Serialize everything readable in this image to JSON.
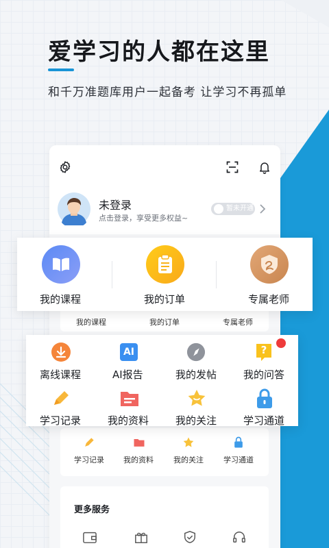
{
  "hero": {
    "title": "爱学习的人都在这里",
    "subtitle": "和千万准题库用户一起备考 让学习不再孤单"
  },
  "colors": {
    "accent_blue": "#1994d6",
    "course_blue": "#6b8df5",
    "order_yellow": "#fbbd15",
    "teacher_tan": "#d9955f"
  },
  "header_icons": [
    "gear-icon",
    "scan-icon",
    "bell-icon"
  ],
  "profile": {
    "name": "未登录",
    "hint": "点击登录，享受更多权益~",
    "vip_badge": "暂未开通"
  },
  "main_card": {
    "items": [
      {
        "label": "我的课程",
        "icon": "book-icon"
      },
      {
        "label": "我的订单",
        "icon": "clipboard-icon"
      },
      {
        "label": "专属老师",
        "icon": "teacher-badge-icon"
      }
    ]
  },
  "inner_main_labels": [
    "我的课程",
    "我的订单",
    "专属老师"
  ],
  "tools_card": {
    "row1": [
      {
        "label": "离线课程",
        "icon": "download-icon"
      },
      {
        "label": "AI报告",
        "icon": "ai-icon",
        "icon_text": "AI"
      },
      {
        "label": "我的发帖",
        "icon": "compass-icon"
      },
      {
        "label": "我的问答",
        "icon": "question-icon",
        "icon_text": "?"
      }
    ],
    "row2": [
      {
        "label": "学习记录",
        "icon": "pencil-icon"
      },
      {
        "label": "我的资料",
        "icon": "folder-icon"
      },
      {
        "label": "我的关注",
        "icon": "star-icon"
      },
      {
        "label": "学习通道",
        "icon": "lock-icon"
      }
    ]
  },
  "inner_tools_labels": [
    "学习记录",
    "我的资料",
    "我的关注",
    "学习通道"
  ],
  "more_services": {
    "title": "更多服务",
    "icons": [
      "wallet-icon",
      "gift-icon",
      "shield-icon",
      "headset-icon"
    ]
  }
}
